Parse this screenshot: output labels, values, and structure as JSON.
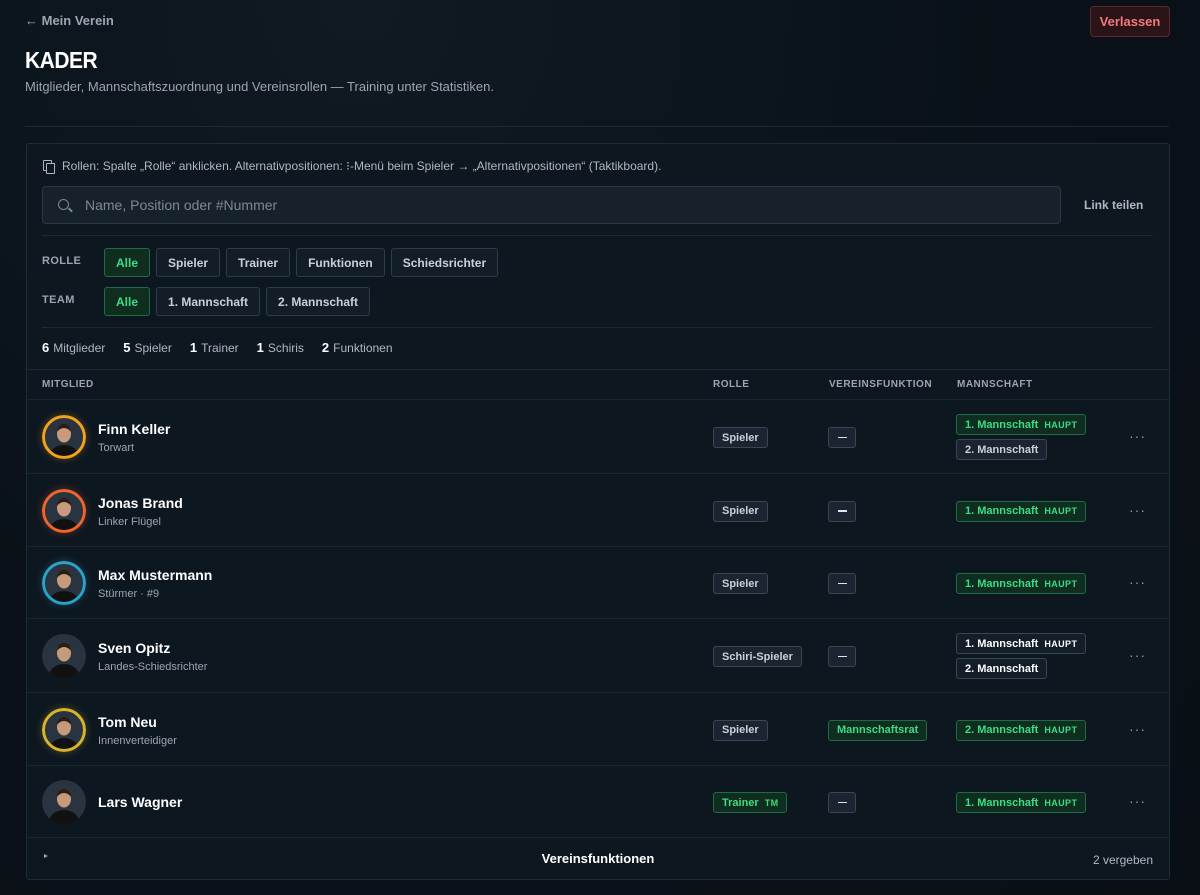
{
  "header": {
    "back_label": "← Mein Verein",
    "leave_label": "Verlassen",
    "title": "KADER",
    "subtitle": "Mitglieder, Mannschaftszuordnung und Vereinsrollen — Training unter Statistiken."
  },
  "hint": "Rollen: Spalte „Rolle“ anklicken. Alternativpositionen: ⁝-Menü beim Spieler → „Alternativpositionen“ (Taktikboard).",
  "search": {
    "placeholder": "Name, Position oder #Nummer",
    "value": ""
  },
  "share_label": "Link teilen",
  "filters": {
    "role": {
      "label": "ROLLE",
      "options": [
        "Alle",
        "Spieler",
        "Trainer",
        "Funktionen",
        "Schiedsrichter"
      ],
      "active": "Alle"
    },
    "team": {
      "label": "TEAM",
      "options": [
        "Alle",
        "1. Mannschaft",
        "2. Mannschaft"
      ],
      "active": "Alle"
    }
  },
  "stats": [
    {
      "count": "6",
      "label": "Mitglieder"
    },
    {
      "count": "5",
      "label": "Spieler"
    },
    {
      "count": "1",
      "label": "Trainer"
    },
    {
      "count": "1",
      "label": "Schiris"
    },
    {
      "count": "2",
      "label": "Funktionen"
    }
  ],
  "table": {
    "headers": {
      "member": "MITGLIED",
      "role": "ROLLE",
      "function": "VEREINSFUNKTION",
      "team": "MANNSCHAFT"
    },
    "rows": [
      {
        "name": "Finn Keller",
        "position": "Torwart",
        "role": "Spieler",
        "function": "",
        "ring": "#f2a31b",
        "teams": [
          {
            "label": "1. Mannschaft",
            "tag": "HAUPT",
            "style": "green"
          },
          {
            "label": "2. Mannschaft",
            "tag": "",
            "style": "grey"
          }
        ]
      },
      {
        "name": "Jonas Brand",
        "position": "Linker Flügel",
        "role": "Spieler",
        "function": "",
        "ring": "#f0652a",
        "teams": [
          {
            "label": "1. Mannschaft",
            "tag": "HAUPT",
            "style": "green"
          }
        ]
      },
      {
        "name": "Max Mustermann",
        "position": "Stürmer · #9",
        "role": "Spieler",
        "function": "",
        "ring": "#2aa3c9",
        "teams": [
          {
            "label": "1. Mannschaft",
            "tag": "HAUPT",
            "style": "green"
          }
        ]
      },
      {
        "name": "Sven Opitz",
        "position": "Landes-Schiedsrichter",
        "role": "Schiri-Spieler",
        "function": "",
        "ring": "",
        "teams": [
          {
            "label": "1. Mannschaft",
            "tag": "HAUPT",
            "style": "white"
          },
          {
            "label": "2. Mannschaft",
            "tag": "",
            "style": "white"
          }
        ]
      },
      {
        "name": "Tom Neu",
        "position": "Innenverteidiger",
        "role": "Spieler",
        "function": "Mannschaftsrat",
        "ring": "#d9b52a",
        "teams": [
          {
            "label": "2. Mannschaft",
            "tag": "HAUPT",
            "style": "green"
          }
        ]
      },
      {
        "name": "Lars Wagner",
        "position": "",
        "role": "Trainer",
        "role_tag": "TM",
        "role_style": "green",
        "function": "",
        "ring": "",
        "teams": [
          {
            "label": "1. Mannschaft",
            "tag": "HAUPT",
            "style": "green"
          }
        ]
      }
    ]
  },
  "footer": {
    "title": "Vereinsfunktionen",
    "count": "2 vergeben"
  }
}
